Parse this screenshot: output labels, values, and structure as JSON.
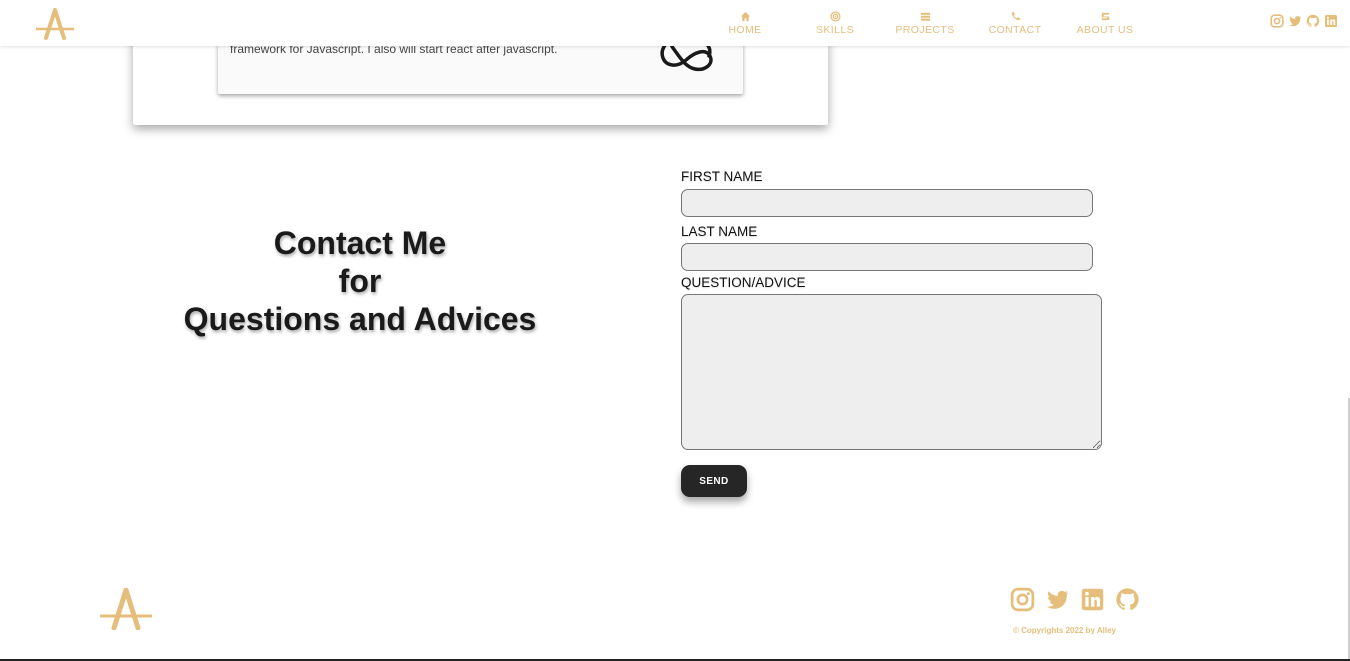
{
  "colors": {
    "accent": "#e6be7b",
    "button": "#262626",
    "field": "#eeeeee"
  },
  "header": {
    "logo_icon": "a-monogram-logo",
    "nav": [
      {
        "label": "HOME",
        "icon": "home-icon"
      },
      {
        "label": "SKILLS",
        "icon": "target-icon"
      },
      {
        "label": "PROJECTS",
        "icon": "stack-icon"
      },
      {
        "label": "CONTACT",
        "icon": "phone-icon"
      },
      {
        "label": "ABOUT US",
        "icon": "address-card-icon"
      }
    ],
    "social": [
      "instagram-icon",
      "twitter-icon",
      "github-icon",
      "linkedin-icon"
    ]
  },
  "skills_card": {
    "text": "framework for Javascript. I also will start react after javascript.",
    "icon": "framework-logo-icon"
  },
  "contact": {
    "heading_lines": [
      "Contact Me",
      "for",
      "Questions and Advices"
    ],
    "first_name_label": "FIRST NAME",
    "first_name_value": "",
    "last_name_label": "LAST NAME",
    "last_name_value": "",
    "question_label": "QUESTION/ADVICE",
    "question_value": "",
    "send_label": "SEND"
  },
  "footer": {
    "logo_icon": "a-monogram-logo",
    "social": [
      "instagram-icon",
      "twitter-icon",
      "linkedin-icon",
      "github-icon"
    ],
    "copyright": "© Copyrights 2022 by Alley"
  }
}
